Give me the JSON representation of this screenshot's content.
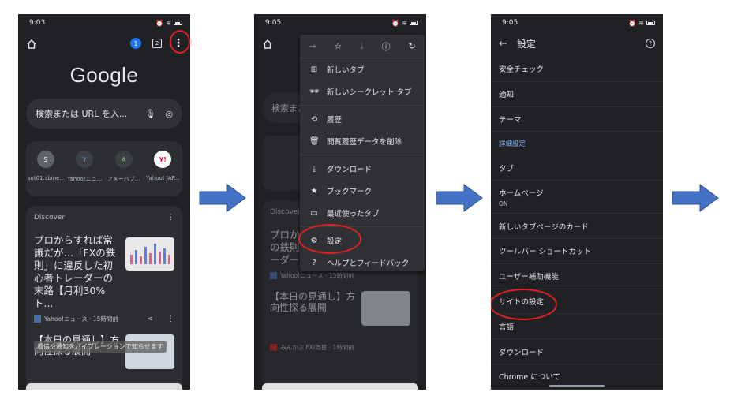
{
  "colors": {
    "arrow_fill": "#4472c4",
    "arrow_stroke": "#2f528f",
    "highlight": "#e02020",
    "phone_bg": "#202124",
    "link_blue": "#8ab4f8"
  },
  "screen1": {
    "time": "9:03",
    "tab_badge": "1",
    "tab_count": "2",
    "logo": "Google",
    "search_placeholder": "検索または URL を入...",
    "shortcuts": [
      {
        "icon": "S",
        "label": "snt01.sbine..."
      },
      {
        "icon": "Y",
        "label": "Yahoo!ニュ..."
      },
      {
        "icon": "A",
        "label": "アメーバブ..."
      },
      {
        "icon": "Y!",
        "label": "Yahoo! JAP..."
      }
    ],
    "discover_label": "Discover",
    "article1": {
      "title": "プロからすれば常識だが…「FXの鉄則」に違反した初心者トレーダーの末路【月利30%ト...",
      "source": "Yahoo!ニュース · 15時間前"
    },
    "article2": {
      "title": "【本日の見通し】方向性探る展開",
      "source": "みんかぶ FX/為替 · 1時間前"
    },
    "toast": "着信や通知をバイブレーションで知らせます"
  },
  "screen2": {
    "time": "9:05",
    "menu_items": [
      {
        "icon": "plus-box-icon",
        "glyph": "⊞",
        "label": "新しいタブ"
      },
      {
        "icon": "incognito-icon",
        "glyph": "🕶",
        "label": "新しいシークレット タブ"
      },
      {
        "icon": "history-icon",
        "glyph": "⟲",
        "label": "履歴"
      },
      {
        "icon": "trash-icon",
        "glyph": "🗑",
        "label": "閲覧履歴データを削除"
      },
      {
        "icon": "download-icon",
        "glyph": "⤓",
        "label": "ダウンロード"
      },
      {
        "icon": "star-icon",
        "glyph": "★",
        "label": "ブックマーク"
      },
      {
        "icon": "recent-tabs-icon",
        "glyph": "▭",
        "label": "最近使ったタブ"
      },
      {
        "icon": "gear-icon",
        "glyph": "⚙",
        "label": "設定"
      },
      {
        "icon": "help-icon",
        "glyph": "?",
        "label": "ヘルプとフィードバック"
      }
    ]
  },
  "screen3": {
    "time": "9:05",
    "title": "設定",
    "items": {
      "safety": "安全チェック",
      "notifications": "通知",
      "theme": "テーマ",
      "advanced": "詳細設定",
      "tabs": "タブ",
      "homepage": "ホームページ",
      "homepage_sub": "ON",
      "ntp_cards": "新しいタブページのカード",
      "toolbar_shortcut": "ツールバー ショートカット",
      "accessibility": "ユーザー補助機能",
      "site_settings": "サイトの設定",
      "language": "言語",
      "downloads": "ダウンロード",
      "about": "Chrome について"
    }
  }
}
